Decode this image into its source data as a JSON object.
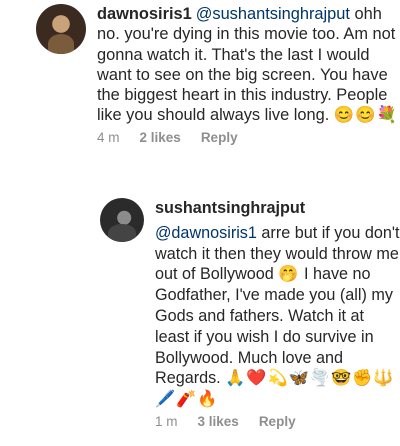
{
  "comments": [
    {
      "username": "dawnosiris1",
      "mention": "@sushantsinghrajput",
      "text": "ohh no. you're dying in this movie too. Am not gonna watch it. That's the last I would want to see on the big screen. You have the biggest heart in this industry. People like you should always live long.",
      "emojis": "😊😊💐",
      "time": "4 m",
      "likes": "2 likes",
      "reply": "Reply"
    },
    {
      "username": "sushantsinghrajput",
      "mention": "@dawnosiris1",
      "text_part1": "arre but if you don't watch it then they would throw me out of Bollywood",
      "emoji_inline": "🤭",
      "text_part2": "I have no Godfather, I've made you (all) my Gods and fathers. Watch it at least if you wish I do survive in Bollywood. Much love and Regards.",
      "emojis": "🙏❤️💫🦋🌪️🤓✊🔱🖊️🧨🔥",
      "time": "1 m",
      "likes": "3 likes",
      "reply": "Reply"
    }
  ]
}
